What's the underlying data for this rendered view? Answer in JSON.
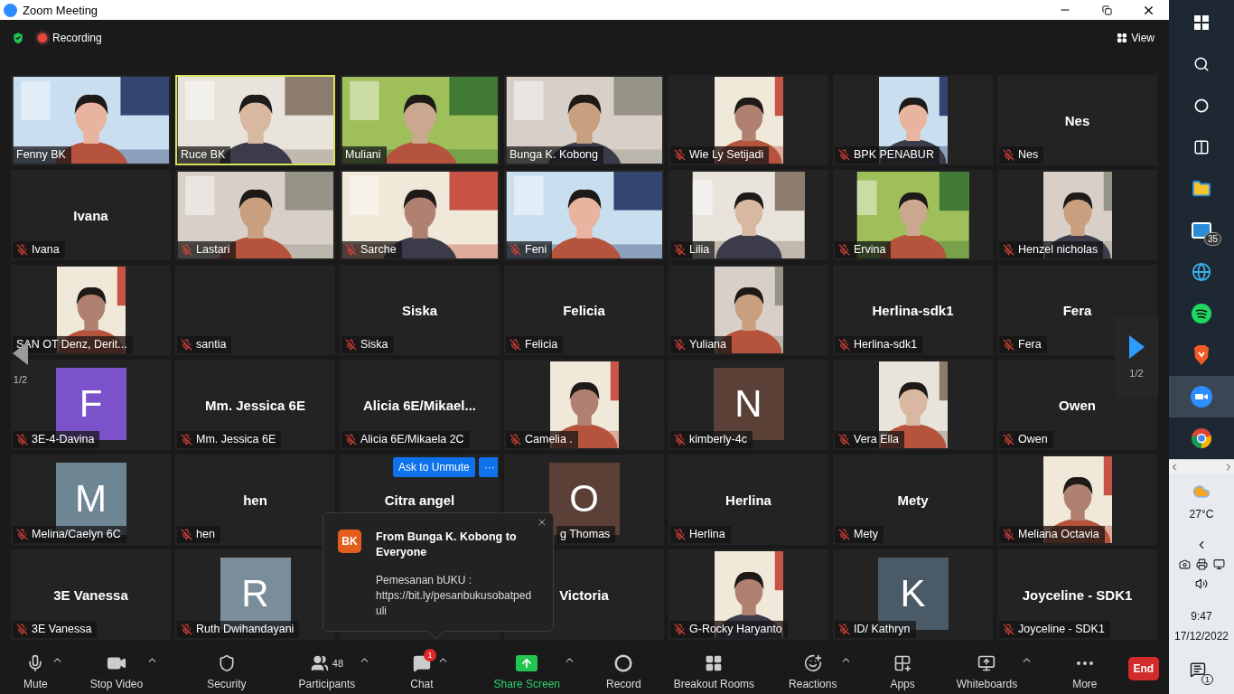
{
  "window": {
    "title": "Zoom Meeting"
  },
  "top_bar": {
    "recording": "Recording",
    "view": "View"
  },
  "tiles": [
    {
      "kind": "video",
      "label": "Fenny BK",
      "muted": false,
      "speaking": false
    },
    {
      "kind": "video",
      "label": "Ruce BK",
      "muted": false,
      "speaking": true
    },
    {
      "kind": "video",
      "label": "Muliani",
      "muted": false,
      "speaking": false
    },
    {
      "kind": "video",
      "label": "Bunga K. Kobong",
      "muted": false,
      "speaking": false
    },
    {
      "kind": "portrait",
      "label": "Wie Ly Setijadi",
      "muted": true,
      "speaking": false
    },
    {
      "kind": "portrait",
      "label": "BPK PENABUR",
      "muted": true,
      "speaking": false
    },
    {
      "kind": "name",
      "display": "Nes",
      "label": "Nes",
      "muted": true,
      "speaking": false
    },
    {
      "kind": "name",
      "display": "Ivana",
      "label": "Ivana",
      "muted": true,
      "speaking": false
    },
    {
      "kind": "video",
      "label": "Lastari",
      "muted": true,
      "speaking": false
    },
    {
      "kind": "video",
      "label": "Sarche",
      "muted": true,
      "speaking": false
    },
    {
      "kind": "video",
      "label": "Feni",
      "muted": true,
      "speaking": false
    },
    {
      "kind": "landscape",
      "label": "Lilia",
      "muted": true,
      "speaking": false
    },
    {
      "kind": "landscape",
      "label": "Ervina",
      "muted": true,
      "speaking": false
    },
    {
      "kind": "portrait",
      "label": "Henzel nicholas",
      "muted": true,
      "speaking": false
    },
    {
      "kind": "portrait",
      "label": "SAN OT Denz, Derit...",
      "muted": false,
      "speaking": false
    },
    {
      "kind": "name",
      "label": "santia",
      "muted": true,
      "speaking": false
    },
    {
      "kind": "name",
      "display": "Siska",
      "label": "Siska",
      "muted": true,
      "speaking": false
    },
    {
      "kind": "name",
      "display": "Felicia",
      "label": "Felicia",
      "muted": true,
      "speaking": false
    },
    {
      "kind": "portrait",
      "label": "Yuliana",
      "muted": true,
      "speaking": false
    },
    {
      "kind": "name",
      "display": "Herlina-sdk1",
      "label": "Herlina-sdk1",
      "muted": true,
      "speaking": false
    },
    {
      "kind": "name",
      "display": "Fera",
      "label": "Fera",
      "muted": true,
      "speaking": false
    },
    {
      "kind": "avatar",
      "letter": "F",
      "color": "#7b52c9",
      "label": "3E-4-Davina",
      "muted": true,
      "speaking": false
    },
    {
      "kind": "name",
      "display": "Mm. Jessica 6E",
      "label": "Mm. Jessica 6E",
      "muted": true,
      "speaking": false
    },
    {
      "kind": "name",
      "display": "Alicia  6E/Mikael...",
      "label": "Alicia 6E/Mikaela 2C",
      "muted": true,
      "speaking": false
    },
    {
      "kind": "portrait",
      "label": "Camelia .",
      "muted": true,
      "speaking": false
    },
    {
      "kind": "avatar",
      "letter": "N",
      "color": "#5b4037",
      "label": "kimberly-4c",
      "muted": true,
      "speaking": false
    },
    {
      "kind": "portrait",
      "label": "Vera Ella",
      "muted": true,
      "speaking": false
    },
    {
      "kind": "name",
      "display": "Owen",
      "label": "Owen",
      "muted": true,
      "speaking": false
    },
    {
      "kind": "avatar",
      "letter": "M",
      "color": "#6e8593",
      "label": "Melina/Caelyn 6C",
      "muted": true,
      "speaking": false
    },
    {
      "kind": "name",
      "display": "hen",
      "label": "hen",
      "muted": true,
      "speaking": false
    },
    {
      "kind": "name",
      "display": "Citra angel",
      "actions": [
        "Ask to Unmute",
        "···"
      ],
      "speaking": false
    },
    {
      "kind": "avatar",
      "letter": "O",
      "color": "#5b4037",
      "label": "g Thomas",
      "covered": true,
      "muted": false,
      "speaking": false
    },
    {
      "kind": "name",
      "display": "Herlina",
      "label": "Herlina",
      "muted": true,
      "speaking": false
    },
    {
      "kind": "name",
      "display": "Mety",
      "label": "Mety",
      "muted": true,
      "speaking": false
    },
    {
      "kind": "portrait",
      "label": "Meliana Octavia",
      "muted": true,
      "speaking": false
    },
    {
      "kind": "name",
      "display": "3E Vanessa",
      "label": "3E Vanessa",
      "muted": true,
      "speaking": false
    },
    {
      "kind": "avatar",
      "letter": "R",
      "color": "#7a8d9a",
      "label": "Ruth Dwihandayani",
      "muted": true,
      "speaking": false
    },
    {
      "kind": "name",
      "speaking": false
    },
    {
      "kind": "name",
      "display": "Victoria",
      "speaking": false
    },
    {
      "kind": "portrait",
      "label": "G-Rocky Haryanto",
      "muted": true,
      "speaking": false
    },
    {
      "kind": "avatar",
      "letter": "K",
      "color": "#4a5a66",
      "label": "ID/ Kathryn",
      "muted": true,
      "speaking": false
    },
    {
      "kind": "name",
      "display": "Joyceline - SDK1",
      "label": "Joyceline - SDK1",
      "muted": true,
      "speaking": false
    }
  ],
  "pager": {
    "left": "1/2",
    "right": "1/2"
  },
  "chat_popup": {
    "avatar": "BK",
    "from": "From Bunga K. Kobong to Everyone",
    "message": "Pemesanan bUKU : https://bit.ly/pesanbukusobatpeduli"
  },
  "toolbar": [
    {
      "kind": "mute",
      "label": "Mute",
      "caret": true
    },
    {
      "kind": "video",
      "label": "Stop Video",
      "caret": true
    },
    {
      "kind": "security",
      "label": "Security",
      "caret": false
    },
    {
      "kind": "participants",
      "label": "Participants",
      "count": "48",
      "caret": true
    },
    {
      "kind": "chat",
      "label": "Chat",
      "badge": "1",
      "caret": true
    },
    {
      "kind": "share",
      "label": "Share Screen",
      "caret": true
    },
    {
      "kind": "record",
      "label": "Record",
      "caret": false
    },
    {
      "kind": "breakout",
      "label": "Breakout Rooms",
      "caret": false
    },
    {
      "kind": "reactions",
      "label": "Reactions",
      "caret": true
    },
    {
      "kind": "apps",
      "label": "Apps",
      "caret": false
    },
    {
      "kind": "whiteboards",
      "label": "Whiteboards",
      "caret": true
    },
    {
      "kind": "more",
      "label": "More",
      "caret": false
    }
  ],
  "end_button": "End",
  "taskbar": {
    "apps": [
      {
        "kind": "windows",
        "selected": false
      },
      {
        "kind": "search",
        "selected": false
      },
      {
        "kind": "cortana",
        "selected": false
      },
      {
        "kind": "taskview",
        "selected": false
      },
      {
        "kind": "explorer",
        "selected": false
      },
      {
        "kind": "mail",
        "selected": false,
        "badge": "35"
      },
      {
        "kind": "edge",
        "selected": false
      },
      {
        "kind": "spotify",
        "selected": false
      },
      {
        "kind": "brave",
        "selected": false
      },
      {
        "kind": "zoom",
        "selected": true
      },
      {
        "kind": "chrome",
        "selected": false
      }
    ],
    "weather": "27°C",
    "time": "9:47",
    "date": "17/12/2022",
    "notifications": "1"
  }
}
